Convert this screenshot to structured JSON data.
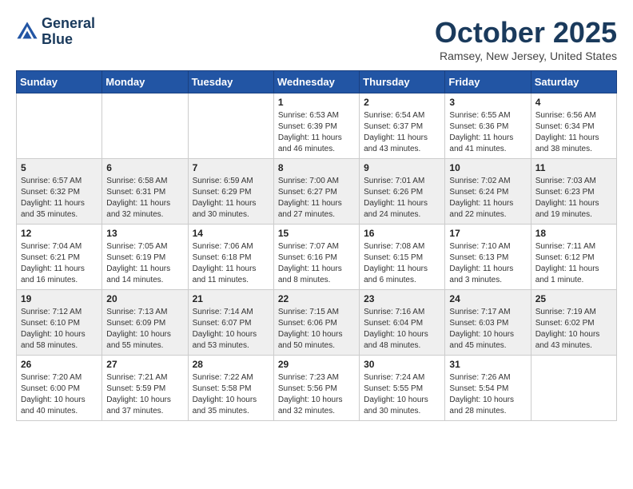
{
  "header": {
    "logo_line1": "General",
    "logo_line2": "Blue",
    "month": "October 2025",
    "location": "Ramsey, New Jersey, United States"
  },
  "weekdays": [
    "Sunday",
    "Monday",
    "Tuesday",
    "Wednesday",
    "Thursday",
    "Friday",
    "Saturday"
  ],
  "weeks": [
    {
      "days": [
        {
          "num": "",
          "info": ""
        },
        {
          "num": "",
          "info": ""
        },
        {
          "num": "",
          "info": ""
        },
        {
          "num": "1",
          "info": "Sunrise: 6:53 AM\nSunset: 6:39 PM\nDaylight: 11 hours\nand 46 minutes."
        },
        {
          "num": "2",
          "info": "Sunrise: 6:54 AM\nSunset: 6:37 PM\nDaylight: 11 hours\nand 43 minutes."
        },
        {
          "num": "3",
          "info": "Sunrise: 6:55 AM\nSunset: 6:36 PM\nDaylight: 11 hours\nand 41 minutes."
        },
        {
          "num": "4",
          "info": "Sunrise: 6:56 AM\nSunset: 6:34 PM\nDaylight: 11 hours\nand 38 minutes."
        }
      ]
    },
    {
      "days": [
        {
          "num": "5",
          "info": "Sunrise: 6:57 AM\nSunset: 6:32 PM\nDaylight: 11 hours\nand 35 minutes."
        },
        {
          "num": "6",
          "info": "Sunrise: 6:58 AM\nSunset: 6:31 PM\nDaylight: 11 hours\nand 32 minutes."
        },
        {
          "num": "7",
          "info": "Sunrise: 6:59 AM\nSunset: 6:29 PM\nDaylight: 11 hours\nand 30 minutes."
        },
        {
          "num": "8",
          "info": "Sunrise: 7:00 AM\nSunset: 6:27 PM\nDaylight: 11 hours\nand 27 minutes."
        },
        {
          "num": "9",
          "info": "Sunrise: 7:01 AM\nSunset: 6:26 PM\nDaylight: 11 hours\nand 24 minutes."
        },
        {
          "num": "10",
          "info": "Sunrise: 7:02 AM\nSunset: 6:24 PM\nDaylight: 11 hours\nand 22 minutes."
        },
        {
          "num": "11",
          "info": "Sunrise: 7:03 AM\nSunset: 6:23 PM\nDaylight: 11 hours\nand 19 minutes."
        }
      ]
    },
    {
      "days": [
        {
          "num": "12",
          "info": "Sunrise: 7:04 AM\nSunset: 6:21 PM\nDaylight: 11 hours\nand 16 minutes."
        },
        {
          "num": "13",
          "info": "Sunrise: 7:05 AM\nSunset: 6:19 PM\nDaylight: 11 hours\nand 14 minutes."
        },
        {
          "num": "14",
          "info": "Sunrise: 7:06 AM\nSunset: 6:18 PM\nDaylight: 11 hours\nand 11 minutes."
        },
        {
          "num": "15",
          "info": "Sunrise: 7:07 AM\nSunset: 6:16 PM\nDaylight: 11 hours\nand 8 minutes."
        },
        {
          "num": "16",
          "info": "Sunrise: 7:08 AM\nSunset: 6:15 PM\nDaylight: 11 hours\nand 6 minutes."
        },
        {
          "num": "17",
          "info": "Sunrise: 7:10 AM\nSunset: 6:13 PM\nDaylight: 11 hours\nand 3 minutes."
        },
        {
          "num": "18",
          "info": "Sunrise: 7:11 AM\nSunset: 6:12 PM\nDaylight: 11 hours\nand 1 minute."
        }
      ]
    },
    {
      "days": [
        {
          "num": "19",
          "info": "Sunrise: 7:12 AM\nSunset: 6:10 PM\nDaylight: 10 hours\nand 58 minutes."
        },
        {
          "num": "20",
          "info": "Sunrise: 7:13 AM\nSunset: 6:09 PM\nDaylight: 10 hours\nand 55 minutes."
        },
        {
          "num": "21",
          "info": "Sunrise: 7:14 AM\nSunset: 6:07 PM\nDaylight: 10 hours\nand 53 minutes."
        },
        {
          "num": "22",
          "info": "Sunrise: 7:15 AM\nSunset: 6:06 PM\nDaylight: 10 hours\nand 50 minutes."
        },
        {
          "num": "23",
          "info": "Sunrise: 7:16 AM\nSunset: 6:04 PM\nDaylight: 10 hours\nand 48 minutes."
        },
        {
          "num": "24",
          "info": "Sunrise: 7:17 AM\nSunset: 6:03 PM\nDaylight: 10 hours\nand 45 minutes."
        },
        {
          "num": "25",
          "info": "Sunrise: 7:19 AM\nSunset: 6:02 PM\nDaylight: 10 hours\nand 43 minutes."
        }
      ]
    },
    {
      "days": [
        {
          "num": "26",
          "info": "Sunrise: 7:20 AM\nSunset: 6:00 PM\nDaylight: 10 hours\nand 40 minutes."
        },
        {
          "num": "27",
          "info": "Sunrise: 7:21 AM\nSunset: 5:59 PM\nDaylight: 10 hours\nand 37 minutes."
        },
        {
          "num": "28",
          "info": "Sunrise: 7:22 AM\nSunset: 5:58 PM\nDaylight: 10 hours\nand 35 minutes."
        },
        {
          "num": "29",
          "info": "Sunrise: 7:23 AM\nSunset: 5:56 PM\nDaylight: 10 hours\nand 32 minutes."
        },
        {
          "num": "30",
          "info": "Sunrise: 7:24 AM\nSunset: 5:55 PM\nDaylight: 10 hours\nand 30 minutes."
        },
        {
          "num": "31",
          "info": "Sunrise: 7:26 AM\nSunset: 5:54 PM\nDaylight: 10 hours\nand 28 minutes."
        },
        {
          "num": "",
          "info": ""
        }
      ]
    }
  ]
}
